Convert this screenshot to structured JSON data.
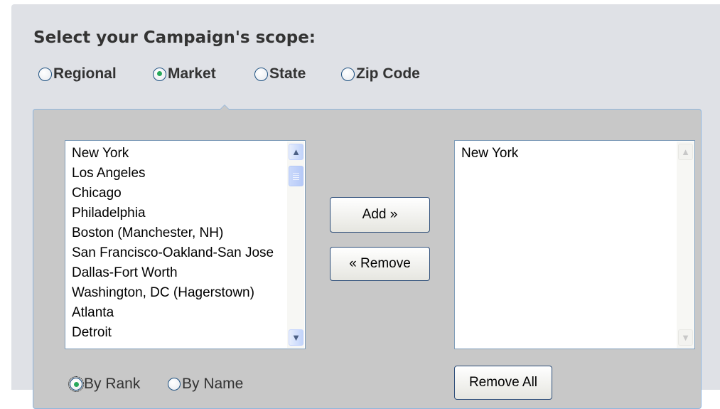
{
  "heading": "Select your Campaign's scope:",
  "scope_options": [
    {
      "label": "Regional",
      "checked": false
    },
    {
      "label": "Market",
      "checked": true
    },
    {
      "label": "State",
      "checked": false
    },
    {
      "label": "Zip Code",
      "checked": false
    }
  ],
  "available_list": {
    "items": [
      "New York",
      "Los Angeles",
      "Chicago",
      "Philadelphia",
      "Boston (Manchester, NH)",
      "San Francisco-Oakland-San Jose",
      "Dallas-Fort Worth",
      "Washington, DC (Hagerstown)",
      "Atlanta",
      "Detroit"
    ]
  },
  "selected_list": {
    "items": [
      "New York"
    ]
  },
  "buttons": {
    "add": "Add »",
    "remove": "« Remove",
    "remove_all": "Remove All"
  },
  "sort_options": [
    {
      "label": "By Rank",
      "checked": true
    },
    {
      "label": "By Name",
      "checked": false
    }
  ],
  "colors": {
    "page_background": "#dfe1e6",
    "panel_background": "#c8c8c8",
    "panel_border": "#8fb6de",
    "radio_dot": "#27a85b",
    "button_border": "#2b4c78"
  },
  "icons": {
    "scroll_up": "chevron-up-icon",
    "scroll_down": "chevron-down-icon",
    "scroll_thumb": "scroll-thumb-grip"
  }
}
